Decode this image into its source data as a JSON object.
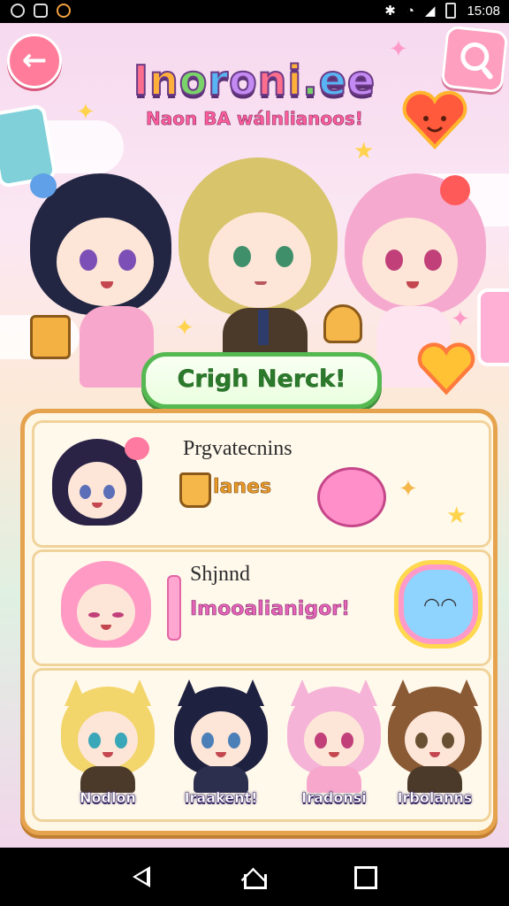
{
  "status_bar": {
    "time": "15:08",
    "icons": [
      "avatar-icon",
      "image-icon",
      "game-icon",
      "bluetooth-icon",
      "wifi-icon",
      "signal-icon",
      "battery-icon"
    ]
  },
  "header": {
    "title": "Inoroni.ee",
    "subtitle": "Naon BA wálnlianoos!"
  },
  "cta": {
    "label": "Crigh Nerck!"
  },
  "rows": [
    {
      "title": "Prgvatecnins",
      "subtitle": "lanes"
    },
    {
      "title": "Shjnnd",
      "subtitle": "Imooalianigor!"
    }
  ],
  "characters": [
    {
      "label": "Nodlon",
      "hair": "#f2d56b",
      "eye": "#3aa7b8"
    },
    {
      "label": "Iraakent!",
      "hair": "#1f2140",
      "eye": "#4b7fb8"
    },
    {
      "label": "Iradonsi",
      "hair": "#f5b3d7",
      "eye": "#c2407a"
    },
    {
      "label": "Irbolanns",
      "hair": "#8a5a35",
      "eye": "#6a5033"
    }
  ],
  "colors": {
    "panel_border": "#e6a34e",
    "cta_border": "#55b851",
    "back_button": "#ff7d9a"
  }
}
